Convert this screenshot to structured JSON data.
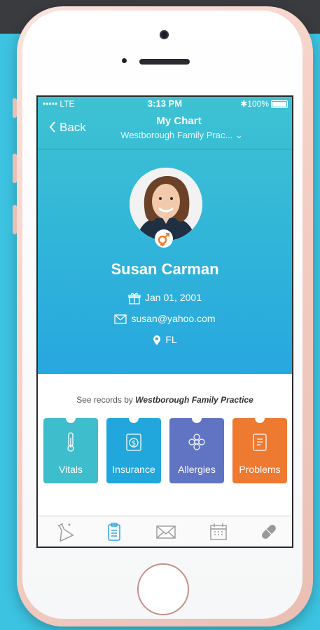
{
  "status_bar": {
    "carrier": "••••• LTE",
    "time": "3:13 PM",
    "battery": "100%"
  },
  "nav": {
    "back_label": "Back",
    "title": "My Chart",
    "subtitle": "Westborough Family Prac... ⌄"
  },
  "profile": {
    "name": "Susan Carman",
    "birthday": "Jan 01, 2001",
    "email": "susan@yahoo.com",
    "location": "FL",
    "gender_symbol": "⚥"
  },
  "records": {
    "prefix": "See records by",
    "practice": "Westborough Family Practice"
  },
  "tiles": [
    {
      "label": "Vitals",
      "color": "#3ebdcc",
      "icon": "thermometer-icon"
    },
    {
      "label": "Insurance",
      "color": "#21a7db",
      "icon": "dollar-doc-icon"
    },
    {
      "label": "Allergies",
      "color": "#6174c4",
      "icon": "flower-icon"
    },
    {
      "label": "Problems",
      "color": "#ee7930",
      "icon": "document-icon"
    }
  ],
  "tabbar": [
    "flask-icon",
    "clipboard-icon",
    "mail-icon",
    "calendar-icon",
    "pill-icon"
  ],
  "colors": {
    "accent": "#2aa8dc",
    "background": "#3cc3e1",
    "phone": "#f5d0c6",
    "gender_badge": "#f07f2b"
  }
}
